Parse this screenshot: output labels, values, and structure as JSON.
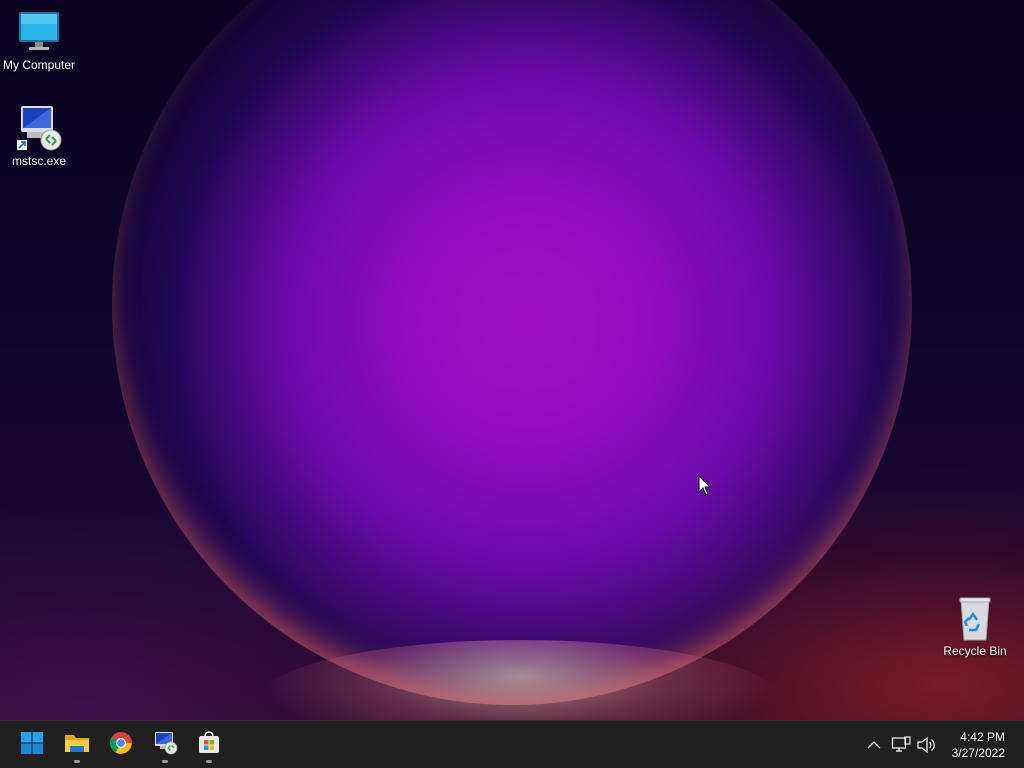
{
  "desktop": {
    "icons": [
      {
        "label": "My Computer",
        "icon": "monitor-icon"
      },
      {
        "label": "mstsc.exe",
        "icon": "remote-desktop-icon"
      },
      {
        "label": "Recycle Bin",
        "icon": "recycle-bin-icon"
      }
    ]
  },
  "taskbar": {
    "apps": [
      {
        "name": "Start",
        "icon": "windows-logo-icon"
      },
      {
        "name": "File Explorer",
        "icon": "folder-icon"
      },
      {
        "name": "Google Chrome",
        "icon": "chrome-icon"
      },
      {
        "name": "Remote Desktop Connection",
        "icon": "remote-desktop-icon"
      },
      {
        "name": "Microsoft Store",
        "icon": "store-icon"
      }
    ],
    "tray": {
      "icons": [
        "chevron-up-icon",
        "network-icon",
        "volume-icon"
      ],
      "time": "4:42 PM",
      "date": "3/27/2022"
    }
  },
  "colors": {
    "taskbar_bg": "#202020",
    "accent": "#0078d4"
  }
}
